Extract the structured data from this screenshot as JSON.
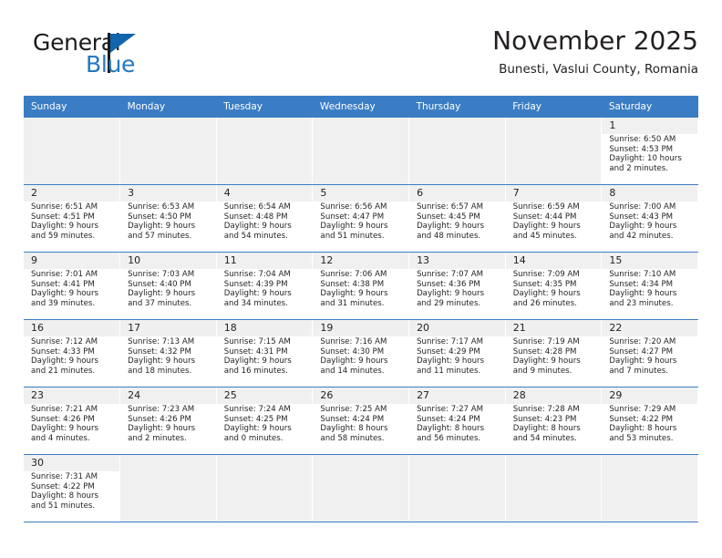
{
  "brand": {
    "name_line1": "General",
    "name_line2": "Blue",
    "icon": "triangle-logo-icon",
    "color_dark": "#1b1b1b",
    "color_blue": "#2577c1"
  },
  "header": {
    "title": "November 2025",
    "subtitle": "Bunesti, Vaslui County, Romania"
  },
  "theme": {
    "header_row_bg": "#3b7dc4",
    "header_row_text": "#ffffff",
    "daynum_bg": "#f0f0f0",
    "cell_border": "#3b7dc4",
    "empty_cell_bg": "#f0f0f0"
  },
  "weekdays": [
    "Sunday",
    "Monday",
    "Tuesday",
    "Wednesday",
    "Thursday",
    "Friday",
    "Saturday"
  ],
  "weeks": [
    [
      {
        "day": "",
        "lines": []
      },
      {
        "day": "",
        "lines": []
      },
      {
        "day": "",
        "lines": []
      },
      {
        "day": "",
        "lines": []
      },
      {
        "day": "",
        "lines": []
      },
      {
        "day": "",
        "lines": []
      },
      {
        "day": "1",
        "lines": [
          "Sunrise: 6:50 AM",
          "Sunset: 4:53 PM",
          "Daylight: 10 hours",
          "and 2 minutes."
        ]
      }
    ],
    [
      {
        "day": "2",
        "lines": [
          "Sunrise: 6:51 AM",
          "Sunset: 4:51 PM",
          "Daylight: 9 hours",
          "and 59 minutes."
        ]
      },
      {
        "day": "3",
        "lines": [
          "Sunrise: 6:53 AM",
          "Sunset: 4:50 PM",
          "Daylight: 9 hours",
          "and 57 minutes."
        ]
      },
      {
        "day": "4",
        "lines": [
          "Sunrise: 6:54 AM",
          "Sunset: 4:48 PM",
          "Daylight: 9 hours",
          "and 54 minutes."
        ]
      },
      {
        "day": "5",
        "lines": [
          "Sunrise: 6:56 AM",
          "Sunset: 4:47 PM",
          "Daylight: 9 hours",
          "and 51 minutes."
        ]
      },
      {
        "day": "6",
        "lines": [
          "Sunrise: 6:57 AM",
          "Sunset: 4:45 PM",
          "Daylight: 9 hours",
          "and 48 minutes."
        ]
      },
      {
        "day": "7",
        "lines": [
          "Sunrise: 6:59 AM",
          "Sunset: 4:44 PM",
          "Daylight: 9 hours",
          "and 45 minutes."
        ]
      },
      {
        "day": "8",
        "lines": [
          "Sunrise: 7:00 AM",
          "Sunset: 4:43 PM",
          "Daylight: 9 hours",
          "and 42 minutes."
        ]
      }
    ],
    [
      {
        "day": "9",
        "lines": [
          "Sunrise: 7:01 AM",
          "Sunset: 4:41 PM",
          "Daylight: 9 hours",
          "and 39 minutes."
        ]
      },
      {
        "day": "10",
        "lines": [
          "Sunrise: 7:03 AM",
          "Sunset: 4:40 PM",
          "Daylight: 9 hours",
          "and 37 minutes."
        ]
      },
      {
        "day": "11",
        "lines": [
          "Sunrise: 7:04 AM",
          "Sunset: 4:39 PM",
          "Daylight: 9 hours",
          "and 34 minutes."
        ]
      },
      {
        "day": "12",
        "lines": [
          "Sunrise: 7:06 AM",
          "Sunset: 4:38 PM",
          "Daylight: 9 hours",
          "and 31 minutes."
        ]
      },
      {
        "day": "13",
        "lines": [
          "Sunrise: 7:07 AM",
          "Sunset: 4:36 PM",
          "Daylight: 9 hours",
          "and 29 minutes."
        ]
      },
      {
        "day": "14",
        "lines": [
          "Sunrise: 7:09 AM",
          "Sunset: 4:35 PM",
          "Daylight: 9 hours",
          "and 26 minutes."
        ]
      },
      {
        "day": "15",
        "lines": [
          "Sunrise: 7:10 AM",
          "Sunset: 4:34 PM",
          "Daylight: 9 hours",
          "and 23 minutes."
        ]
      }
    ],
    [
      {
        "day": "16",
        "lines": [
          "Sunrise: 7:12 AM",
          "Sunset: 4:33 PM",
          "Daylight: 9 hours",
          "and 21 minutes."
        ]
      },
      {
        "day": "17",
        "lines": [
          "Sunrise: 7:13 AM",
          "Sunset: 4:32 PM",
          "Daylight: 9 hours",
          "and 18 minutes."
        ]
      },
      {
        "day": "18",
        "lines": [
          "Sunrise: 7:15 AM",
          "Sunset: 4:31 PM",
          "Daylight: 9 hours",
          "and 16 minutes."
        ]
      },
      {
        "day": "19",
        "lines": [
          "Sunrise: 7:16 AM",
          "Sunset: 4:30 PM",
          "Daylight: 9 hours",
          "and 14 minutes."
        ]
      },
      {
        "day": "20",
        "lines": [
          "Sunrise: 7:17 AM",
          "Sunset: 4:29 PM",
          "Daylight: 9 hours",
          "and 11 minutes."
        ]
      },
      {
        "day": "21",
        "lines": [
          "Sunrise: 7:19 AM",
          "Sunset: 4:28 PM",
          "Daylight: 9 hours",
          "and 9 minutes."
        ]
      },
      {
        "day": "22",
        "lines": [
          "Sunrise: 7:20 AM",
          "Sunset: 4:27 PM",
          "Daylight: 9 hours",
          "and 7 minutes."
        ]
      }
    ],
    [
      {
        "day": "23",
        "lines": [
          "Sunrise: 7:21 AM",
          "Sunset: 4:26 PM",
          "Daylight: 9 hours",
          "and 4 minutes."
        ]
      },
      {
        "day": "24",
        "lines": [
          "Sunrise: 7:23 AM",
          "Sunset: 4:26 PM",
          "Daylight: 9 hours",
          "and 2 minutes."
        ]
      },
      {
        "day": "25",
        "lines": [
          "Sunrise: 7:24 AM",
          "Sunset: 4:25 PM",
          "Daylight: 9 hours",
          "and 0 minutes."
        ]
      },
      {
        "day": "26",
        "lines": [
          "Sunrise: 7:25 AM",
          "Sunset: 4:24 PM",
          "Daylight: 8 hours",
          "and 58 minutes."
        ]
      },
      {
        "day": "27",
        "lines": [
          "Sunrise: 7:27 AM",
          "Sunset: 4:24 PM",
          "Daylight: 8 hours",
          "and 56 minutes."
        ]
      },
      {
        "day": "28",
        "lines": [
          "Sunrise: 7:28 AM",
          "Sunset: 4:23 PM",
          "Daylight: 8 hours",
          "and 54 minutes."
        ]
      },
      {
        "day": "29",
        "lines": [
          "Sunrise: 7:29 AM",
          "Sunset: 4:22 PM",
          "Daylight: 8 hours",
          "and 53 minutes."
        ]
      }
    ],
    [
      {
        "day": "30",
        "lines": [
          "Sunrise: 7:31 AM",
          "Sunset: 4:22 PM",
          "Daylight: 8 hours",
          "and 51 minutes."
        ]
      },
      {
        "day": "",
        "lines": []
      },
      {
        "day": "",
        "lines": []
      },
      {
        "day": "",
        "lines": []
      },
      {
        "day": "",
        "lines": []
      },
      {
        "day": "",
        "lines": []
      },
      {
        "day": "",
        "lines": []
      }
    ]
  ]
}
